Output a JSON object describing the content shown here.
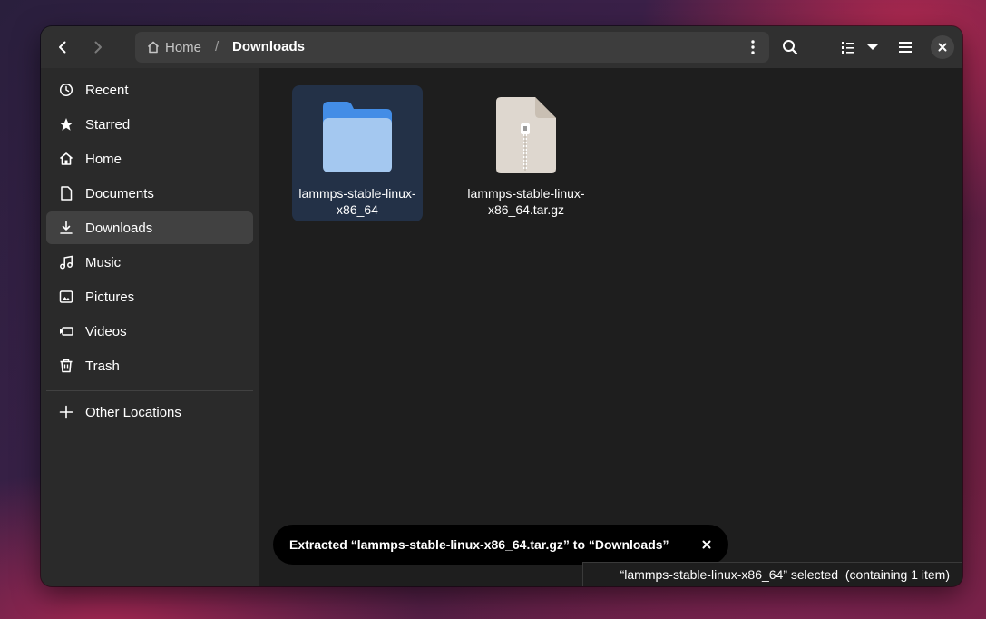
{
  "header": {
    "back_icon": "back-arrow-icon",
    "forward_icon": "forward-arrow-icon",
    "path": {
      "home_label": "Home",
      "separator": "/",
      "current_label": "Downloads"
    },
    "search_icon": "search-icon",
    "view_icon": "list-view-icon",
    "menu_icon": "hamburger-menu-icon",
    "close_icon": "close-icon"
  },
  "sidebar": {
    "items": [
      {
        "label": "Recent",
        "icon": "clock-icon"
      },
      {
        "label": "Starred",
        "icon": "star-icon"
      },
      {
        "label": "Home",
        "icon": "home-icon"
      },
      {
        "label": "Documents",
        "icon": "document-icon"
      },
      {
        "label": "Downloads",
        "icon": "download-icon",
        "active": true
      },
      {
        "label": "Music",
        "icon": "music-icon"
      },
      {
        "label": "Pictures",
        "icon": "picture-icon"
      },
      {
        "label": "Videos",
        "icon": "video-icon"
      },
      {
        "label": "Trash",
        "icon": "trash-icon"
      }
    ],
    "other_locations": {
      "label": "Other Locations",
      "icon": "plus-icon"
    }
  },
  "files": [
    {
      "name": "lammps-stable-linux-x86_64",
      "type": "folder",
      "selected": true
    },
    {
      "name": "lammps-stable-linux-x86_64.tar.gz",
      "type": "archive",
      "selected": false
    }
  ],
  "toast": {
    "message": "Extracted “lammps-stable-linux-x86_64.tar.gz” to “Downloads”"
  },
  "status": {
    "text": "“lammps-stable-linux-x86_64” selected  (containing 1 item)"
  },
  "colors": {
    "accent": "#3584e4",
    "selection": "#233147",
    "folder_front": "#a4c8f0",
    "folder_back": "#438de6",
    "archive": "#ded7cf"
  }
}
